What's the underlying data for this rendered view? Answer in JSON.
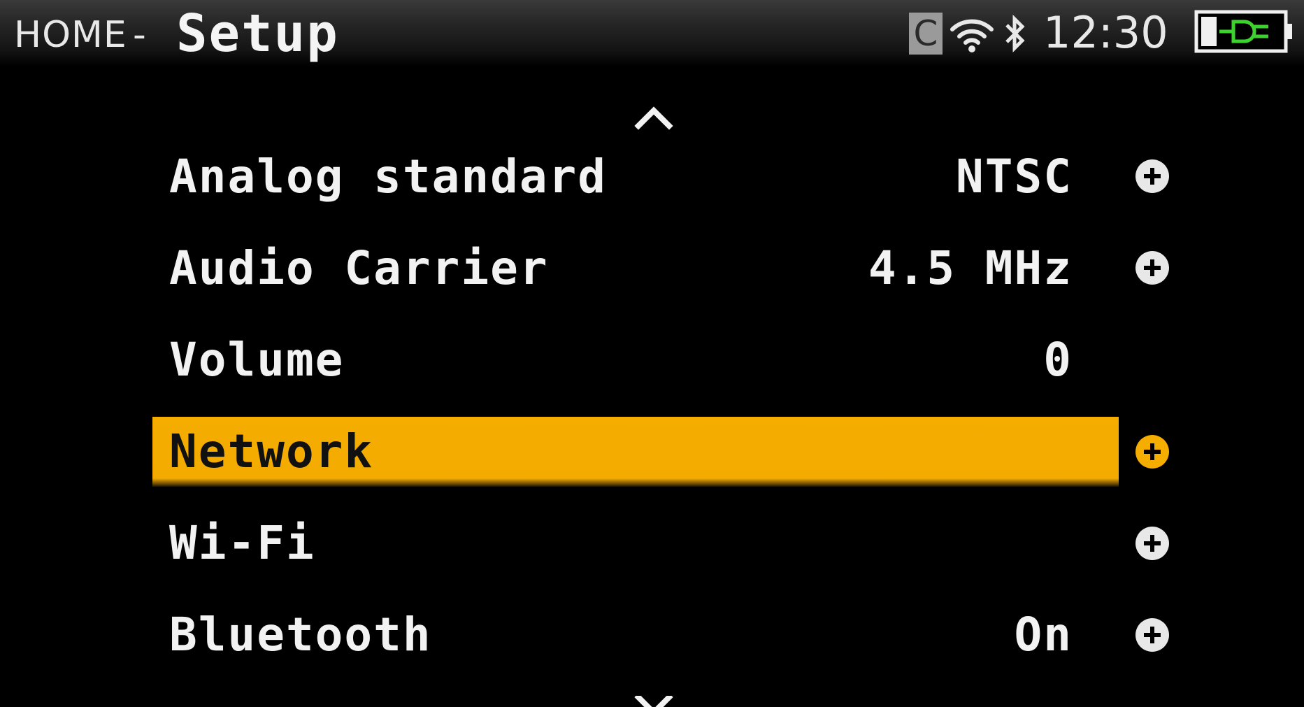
{
  "header": {
    "breadcrumb": "HOME",
    "separator": "-",
    "title": "Setup",
    "status": {
      "c_badge": "C",
      "wifi_icon": "wifi-icon",
      "bluetooth_icon": "bluetooth-icon",
      "time": "12:30",
      "battery_icon": "battery-charging-icon",
      "battery_color": "#3cd42c"
    }
  },
  "menu": {
    "scroll_up_icon": "chevron-up-icon",
    "scroll_down_icon": "chevron-down-icon",
    "highlight_color": "#f5ad00",
    "items": [
      {
        "label": "Analog standard",
        "value": "NTSC",
        "expandable": true
      },
      {
        "label": "Audio Carrier",
        "value": "4.5 MHz",
        "expandable": true
      },
      {
        "label": "Volume",
        "value": "0",
        "expandable": false
      },
      {
        "label": "Network",
        "value": "",
        "expandable": true,
        "selected": true
      },
      {
        "label": "Wi-Fi",
        "value": "",
        "expandable": true
      },
      {
        "label": "Bluetooth",
        "value": "On",
        "expandable": true
      }
    ]
  }
}
